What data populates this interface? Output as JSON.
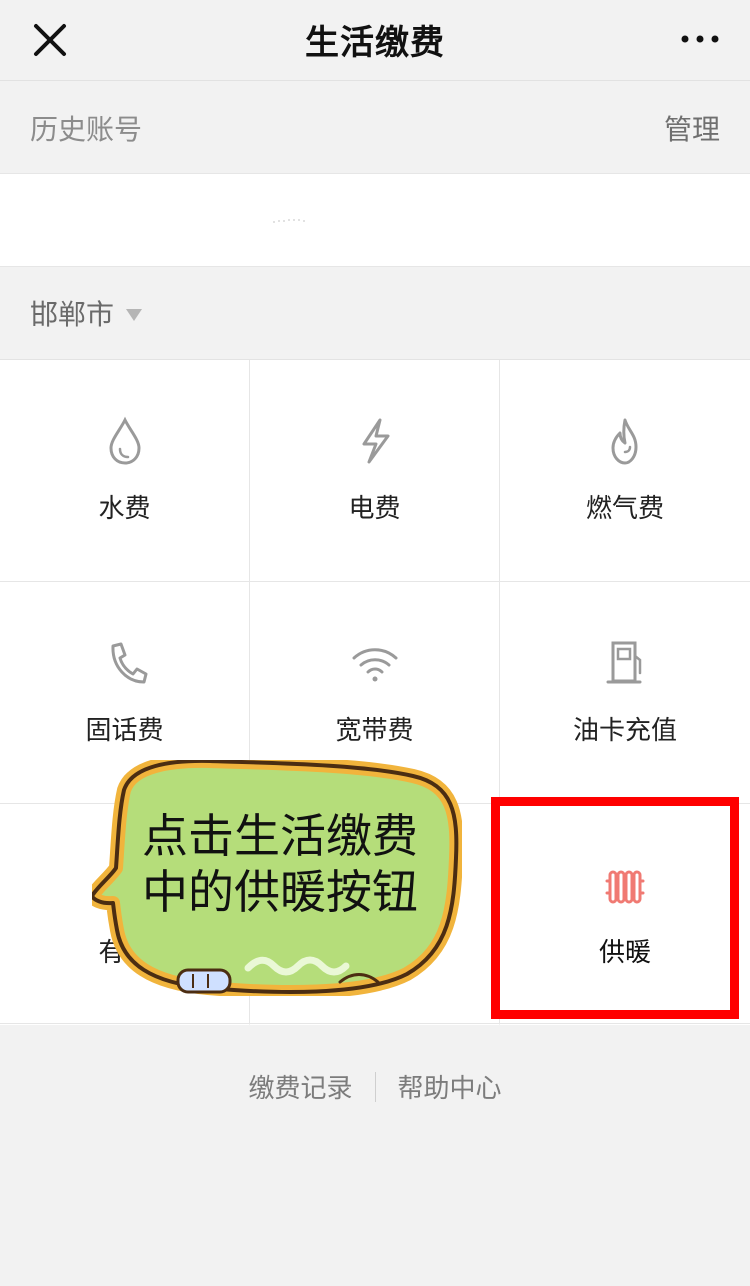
{
  "header": {
    "title": "生活缴费"
  },
  "history": {
    "label": "历史账号",
    "manage": "管理"
  },
  "city": {
    "name": "邯郸市"
  },
  "services": [
    {
      "label": "水费",
      "icon": "water-drop-icon"
    },
    {
      "label": "电费",
      "icon": "lightning-icon"
    },
    {
      "label": "燃气费",
      "icon": "flame-icon"
    },
    {
      "label": "固话费",
      "icon": "phone-icon"
    },
    {
      "label": "宽带费",
      "icon": "wifi-icon"
    },
    {
      "label": "油卡充值",
      "icon": "fuel-pump-icon"
    },
    {
      "label": "有线",
      "icon": "tv-icon"
    },
    {
      "label": "",
      "icon": ""
    },
    {
      "label": "供暖",
      "icon": "radiator-icon"
    }
  ],
  "footer": {
    "records": "缴费记录",
    "help": "帮助中心"
  },
  "annotation": {
    "text": "点击生活缴费中的供暖按钮"
  },
  "colors": {
    "highlight": "#ff0000",
    "heating_icon": "#f07a73",
    "sticker_fill": "#b5dd7a",
    "sticker_outline": "#f1b43c"
  }
}
